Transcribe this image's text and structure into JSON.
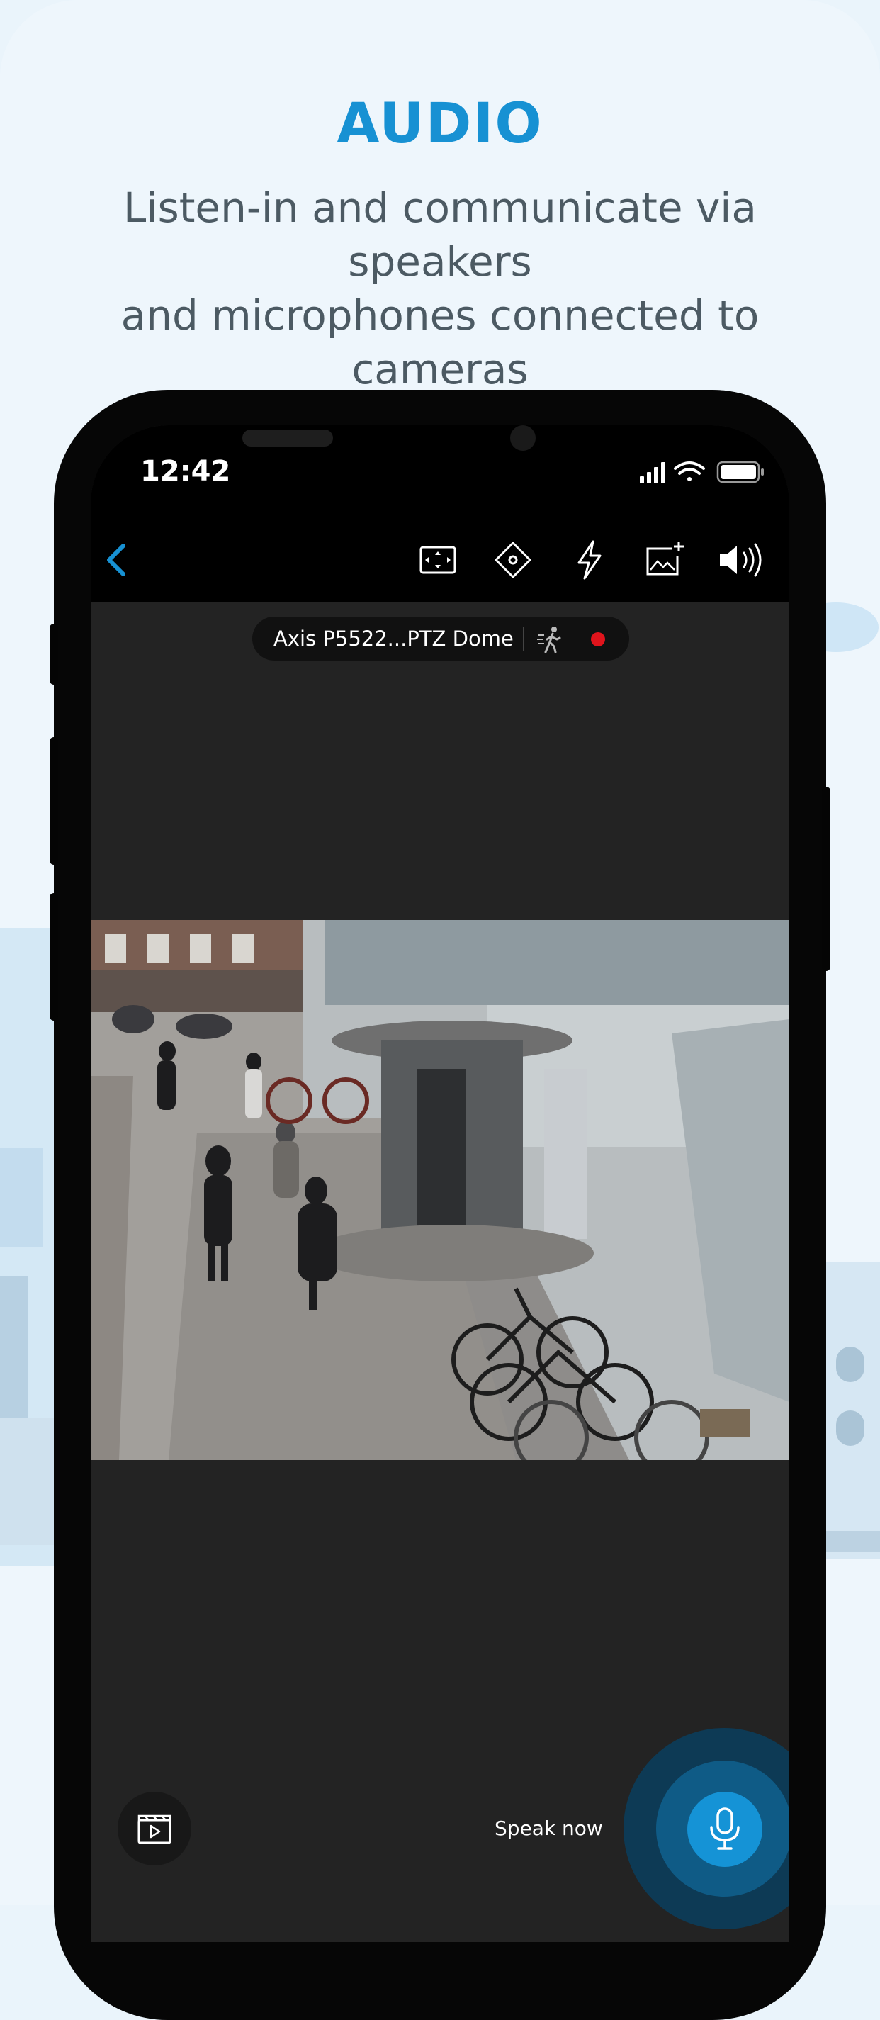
{
  "promo": {
    "headline": "AUDIO",
    "subheadline_line1": "Listen-in and communicate via speakers",
    "subheadline_line2": "and microphones connected to cameras"
  },
  "status_bar": {
    "time": "12:42",
    "icons": [
      "signal-icon",
      "wifi-icon",
      "battery-icon"
    ]
  },
  "toolbar": {
    "back_icon": "chevron-left-icon",
    "actions": [
      "fit-screen-icon",
      "ptz-control-icon",
      "io-trigger-icon",
      "snapshot-icon",
      "speaker-icon"
    ]
  },
  "camera": {
    "name": "Axis P5522...PTZ Dome",
    "motion_icon": "motion-walk-icon",
    "recording": true,
    "recording_color": "#e0141c"
  },
  "bottom_bar": {
    "clips_icon": "clapperboard-icon",
    "speak_label": "Speak now",
    "mic_icon": "microphone-icon"
  },
  "colors": {
    "accent": "#1791d3",
    "mic_button": "#1593d6",
    "screen_bg": "#232323"
  }
}
